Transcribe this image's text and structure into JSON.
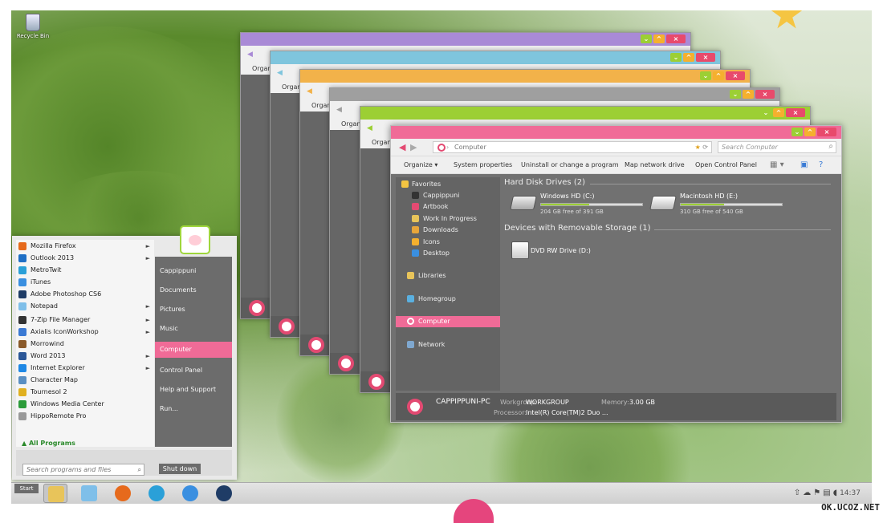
{
  "desktop": {
    "recycle_bin": "Recycle Bin"
  },
  "back_windows": [
    {
      "color": "#a98ad6",
      "organize": "Organ"
    },
    {
      "color": "#7fc5dd",
      "organize": "Organ"
    },
    {
      "color": "#f2b24a",
      "organize": "Organ"
    },
    {
      "color": "#9f9f9f",
      "organize": "Organ"
    },
    {
      "color": "#9ccf34",
      "organize": "Organ"
    }
  ],
  "explorer": {
    "accent": "#f06b97",
    "address": "Computer",
    "search_placeholder": "Search Computer",
    "commands": {
      "organize": "Organize",
      "system_properties": "System properties",
      "uninstall": "Uninstall or change a program",
      "map_drive": "Map network drive",
      "control_panel": "Open Control Panel"
    },
    "nav": {
      "favorites": "Favorites",
      "fav_items": [
        "Cappippuni",
        "Artbook",
        "Work In Progress",
        "Downloads",
        "Icons",
        "Desktop"
      ],
      "libraries": "Libraries",
      "homegroup": "Homegroup",
      "computer": "Computer",
      "network": "Network"
    },
    "groups": {
      "hdd": "Hard Disk Drives (2)",
      "removable": "Devices with Removable Storage (1)"
    },
    "drives": [
      {
        "name": "Windows HD (C:)",
        "free": "204 GB free of 391 GB",
        "used_fraction": 0.48
      },
      {
        "name": "Macintosh HD (E:)",
        "free": "310 GB free of 540 GB",
        "used_fraction": 0.43
      }
    ],
    "dvd": {
      "name": "DVD RW Drive (D:)"
    },
    "details": {
      "pc_name": "CAPPIPPUNI-PC",
      "workgroup_label": "Workgroup:",
      "workgroup": "WORKGROUP",
      "memory_label": "Memory:",
      "memory": "3.00 GB",
      "processor_label": "Processor:",
      "processor": "Intel(R) Core(TM)2 Duo ..."
    }
  },
  "start_menu": {
    "programs": [
      {
        "label": "Mozilla Firefox",
        "arrow": true,
        "color": "#e66a1c"
      },
      {
        "label": "Outlook 2013",
        "arrow": true,
        "color": "#1f6fc5"
      },
      {
        "label": "MetroTwit",
        "arrow": false,
        "color": "#2aa0d8"
      },
      {
        "label": "iTunes",
        "arrow": false,
        "color": "#3a8fe0"
      },
      {
        "label": "Adobe Photoshop CS6",
        "arrow": false,
        "color": "#1f3c66"
      },
      {
        "label": "Notepad",
        "arrow": true,
        "color": "#7fbfe9"
      },
      {
        "label": "7-Zip File Manager",
        "arrow": true,
        "color": "#333333"
      },
      {
        "label": "Axialis IconWorkshop",
        "arrow": true,
        "color": "#3b7ad4"
      },
      {
        "label": "Morrowind",
        "arrow": false,
        "color": "#8a5a2a"
      },
      {
        "label": "Word 2013",
        "arrow": true,
        "color": "#2b5797"
      },
      {
        "label": "Internet Explorer",
        "arrow": true,
        "color": "#1e88e5"
      },
      {
        "label": "Character Map",
        "arrow": false,
        "color": "#5a8fc2"
      },
      {
        "label": "Tournesol 2",
        "arrow": false,
        "color": "#e0b020"
      },
      {
        "label": "Windows Media Center",
        "arrow": false,
        "color": "#2c9c3a"
      },
      {
        "label": "HippoRemote Pro",
        "arrow": false,
        "color": "#999999"
      }
    ],
    "right_items": [
      "Cappippuni",
      "Documents",
      "Pictures",
      "Music",
      "Computer",
      "Control Panel",
      "Help and Support",
      "Run..."
    ],
    "selected_right": "Computer",
    "all_programs": "All Programs",
    "search_placeholder": "Search programs and files",
    "shutdown": "Shut down"
  },
  "taskbar": {
    "start": "Start",
    "pinned": [
      {
        "icon": "explorer-icon",
        "color": "#e8c45a"
      },
      {
        "icon": "notepad-icon",
        "color": "#7fbfe9"
      },
      {
        "icon": "firefox-icon",
        "color": "#e66a1c"
      },
      {
        "icon": "twitter-icon",
        "color": "#2aa0d8"
      },
      {
        "icon": "itunes-icon",
        "color": "#3a8fe0"
      },
      {
        "icon": "photoshop-icon",
        "color": "#1f3c66"
      }
    ],
    "time": "14:37"
  },
  "watermark": "OK.UCOZ.NET"
}
